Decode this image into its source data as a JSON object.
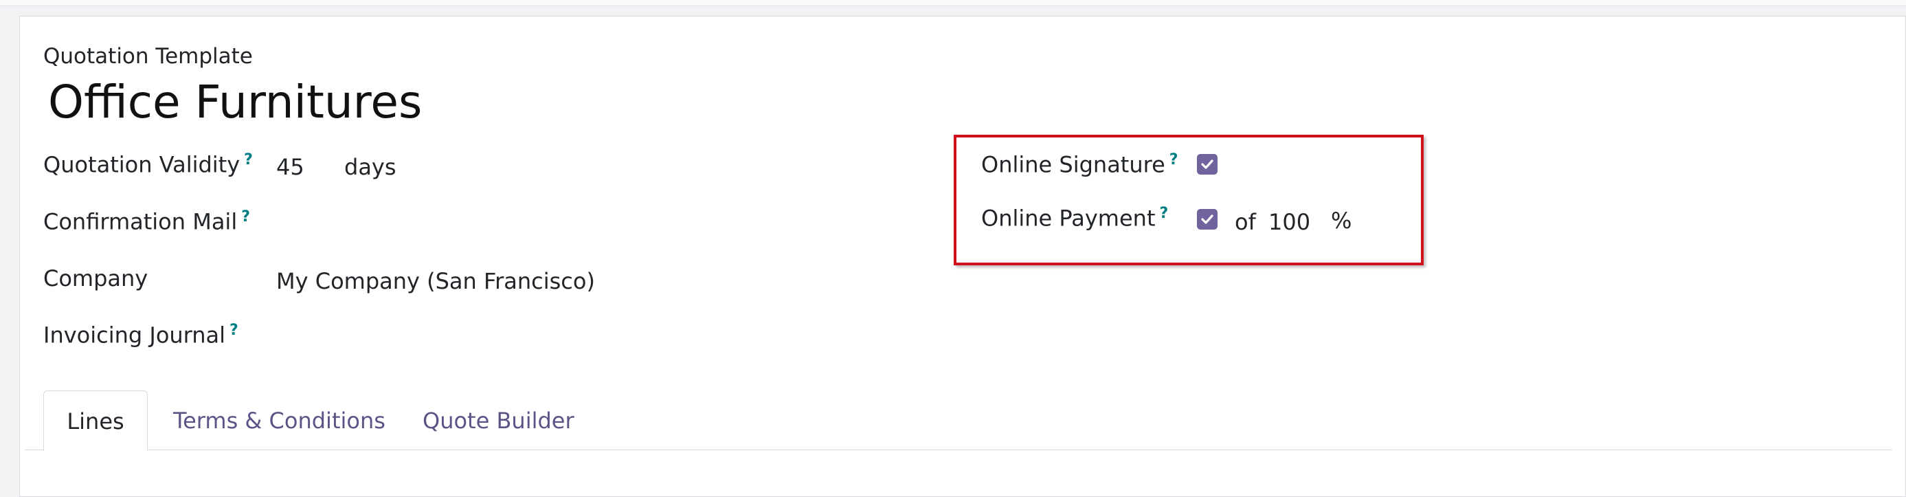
{
  "form": {
    "record_type": "Quotation Template",
    "name": "Office Furnitures"
  },
  "fields_left": {
    "validity_label": "Quotation Validity",
    "validity_value": "45",
    "validity_unit": "days",
    "mail_label": "Confirmation Mail",
    "company_label": "Company",
    "company_value": "My Company (San Francisco)",
    "journal_label": "Invoicing Journal"
  },
  "fields_right": {
    "signature_label": "Online Signature",
    "signature_checked": true,
    "payment_label": "Online Payment",
    "payment_checked": true,
    "payment_of": "of",
    "payment_percent": "100",
    "payment_unit": "%"
  },
  "help_marker": "?",
  "tabs": [
    {
      "label": "Lines",
      "active": true
    },
    {
      "label": "Terms & Conditions",
      "active": false
    },
    {
      "label": "Quote Builder",
      "active": false
    }
  ],
  "colors": {
    "accent": "#71639e",
    "help": "#017e84",
    "highlight": "#d0121c",
    "tab_link": "#5e5386"
  }
}
